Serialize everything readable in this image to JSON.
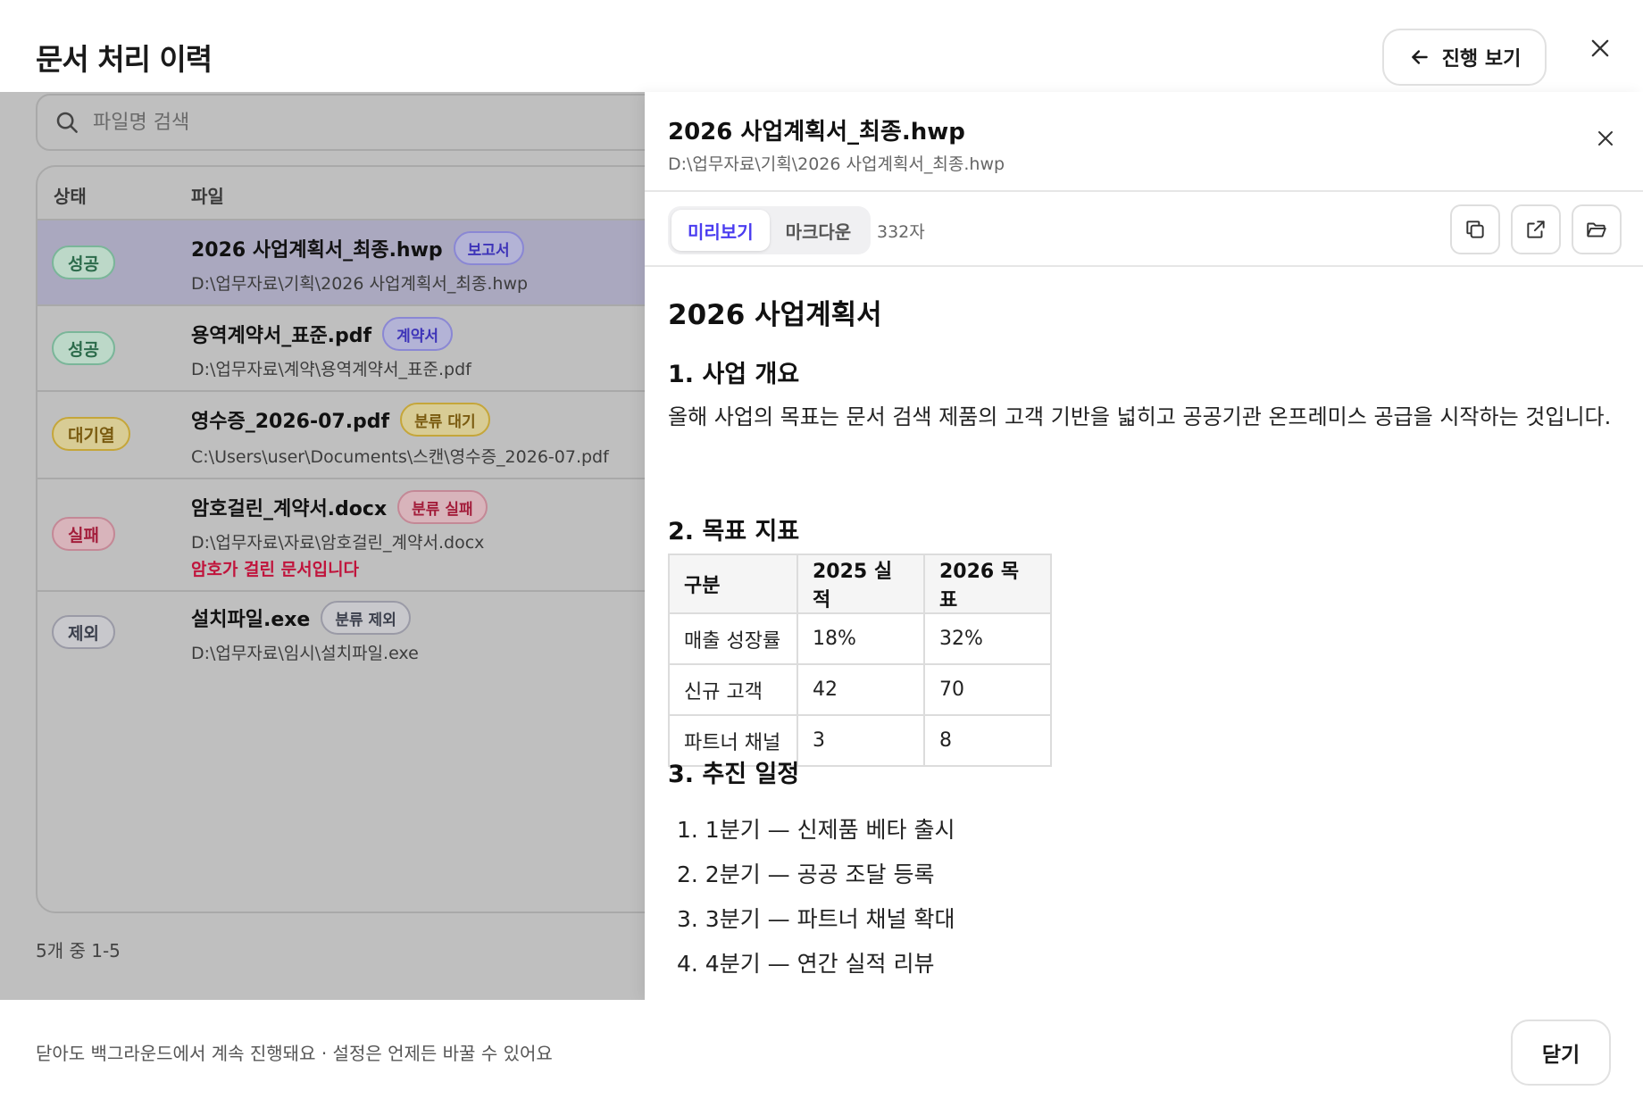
{
  "header": {
    "title": "문서 처리 이력",
    "progress_label": "진행 보기"
  },
  "search": {
    "placeholder": "파일명 검색"
  },
  "table": {
    "col_status": "상태",
    "col_file": "파일",
    "rows": [
      {
        "status": "성공",
        "name": "2026 사업계획서_최종.hwp",
        "tag": "보고서",
        "path": "D:\\업무자료\\기획\\2026 사업계획서_최종.hwp",
        "error": ""
      },
      {
        "status": "성공",
        "name": "용역계약서_표준.pdf",
        "tag": "계약서",
        "path": "D:\\업무자료\\계약\\용역계약서_표준.pdf",
        "error": ""
      },
      {
        "status": "대기열",
        "name": "영수증_2026-07.pdf",
        "tag": "분류 대기",
        "path": "C:\\Users\\user\\Documents\\스캔\\영수증_2026-07.pdf",
        "error": ""
      },
      {
        "status": "실패",
        "name": "암호걸린_계약서.docx",
        "tag": "분류 실패",
        "path": "D:\\업무자료\\자료\\암호걸린_계약서.docx",
        "error": "암호가 걸린 문서입니다"
      },
      {
        "status": "제외",
        "name": "설치파일.exe",
        "tag": "분류 제외",
        "path": "D:\\업무자료\\임시\\설치파일.exe",
        "error": ""
      }
    ]
  },
  "pager": "5개 중 1-5",
  "footer": {
    "note": "닫아도 백그라운드에서 계속 진행돼요 · 설정은 언제든 바꿀 수 있어요",
    "close_label": "닫기"
  },
  "detail": {
    "title": "2026 사업계획서_최종.hwp",
    "path": "D:\\업무자료\\기획\\2026 사업계획서_최종.hwp",
    "tab_preview": "미리보기",
    "tab_markdown": "마크다운",
    "char_count": "332자",
    "doc": {
      "h1": "2026 사업계획서",
      "s1_title": "1. 사업 개요",
      "s1_body": "올해 사업의 목표는 문서 검색 제품의 고객 기반을 넓히고 공공기관 온프레미스 공급을 시작하는 것입니다.",
      "s2_title": "2. 목표 지표",
      "table_headers": [
        "구분",
        "2025 실적",
        "2026 목표"
      ],
      "table_rows": [
        [
          "매출 성장률",
          "18%",
          "32%"
        ],
        [
          "신규 고객",
          "42",
          "70"
        ],
        [
          "파트너 채널",
          "3",
          "8"
        ]
      ],
      "s3_title": "3. 추진 일정",
      "schedule": [
        "1. 1분기 — 신제품 베타 출시",
        "2. 2분기 — 공공 조달 등록",
        "3. 3분기 — 파트너 채널 확대",
        "4. 4분기 — 연간 실적 리뷰"
      ]
    }
  }
}
